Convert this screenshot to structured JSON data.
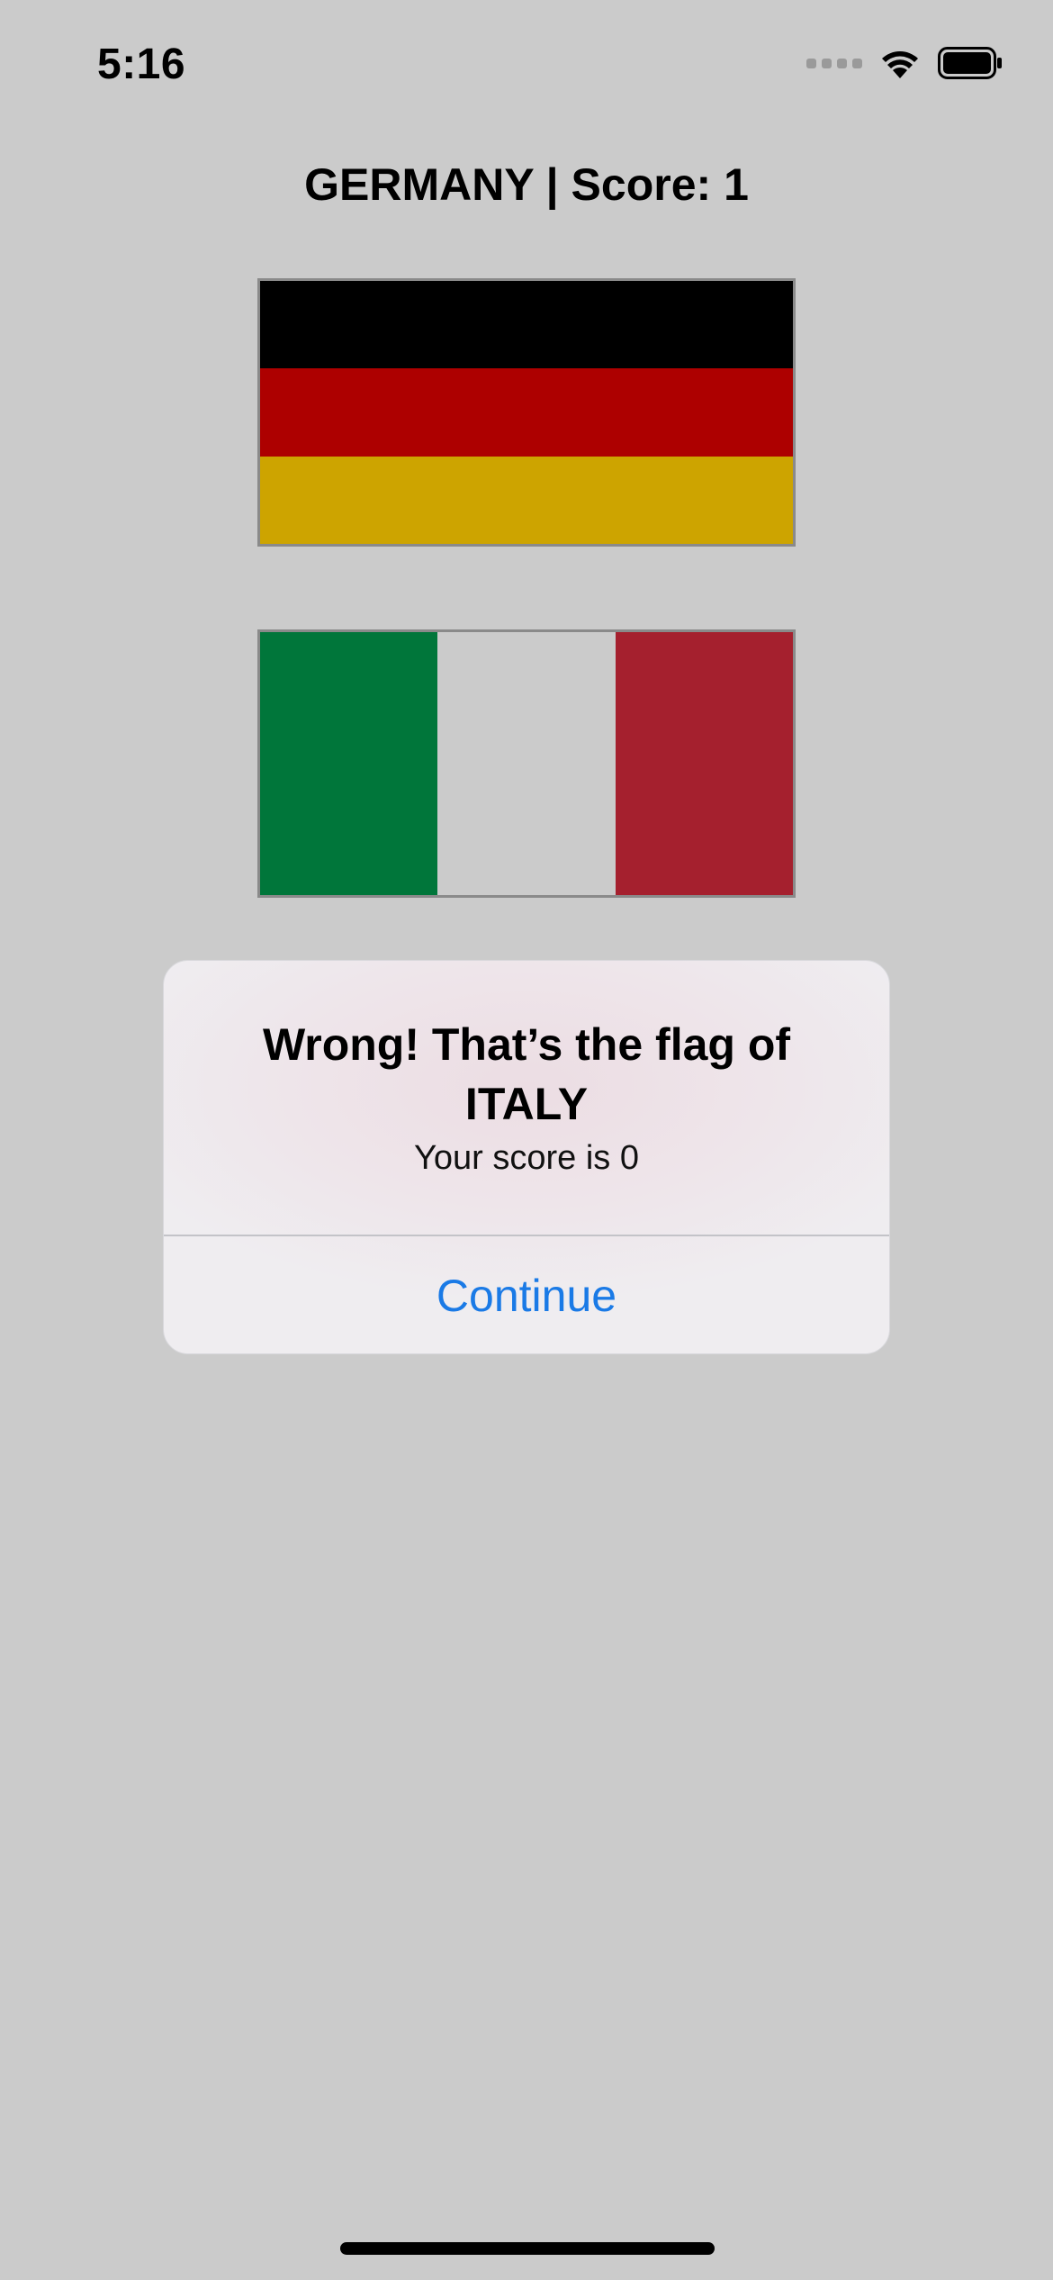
{
  "status_bar": {
    "time": "5:16",
    "icons": [
      "cellular-signal-icon",
      "wifi-icon",
      "battery-icon"
    ]
  },
  "game": {
    "title": "GERMANY | Score: 1"
  },
  "flags": [
    {
      "country": "Germany",
      "orientation": "horizontal",
      "stripes": [
        "#000000",
        "#ad0000",
        "#cda400"
      ]
    },
    {
      "country": "Italy",
      "orientation": "vertical",
      "stripes": [
        "#00763a",
        "#cbcbcb",
        "#a5202e"
      ]
    }
  ],
  "alert": {
    "title": "Wrong! That’s the flag of ITALY",
    "message": "Your score is 0",
    "button_label": "Continue"
  },
  "colors": {
    "background": "#cbcbcb",
    "accent": "#1a7ae6"
  }
}
